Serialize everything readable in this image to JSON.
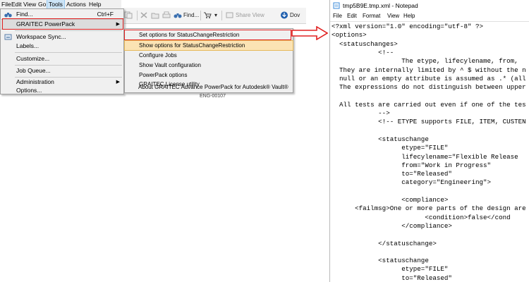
{
  "vault_menubar": {
    "items": [
      "File",
      "Edit",
      "View",
      "Go",
      "Tools",
      "Actions",
      "Help"
    ],
    "active": "Tools"
  },
  "vault_toolbar": {
    "find_label": "Find...",
    "share_view_label": "Share View",
    "download_label": "Dov"
  },
  "tools_menu": {
    "find": {
      "label": "Find...",
      "shortcut": "Ctrl+F"
    },
    "graitec_powerpack": "GRAITEC PowerPack",
    "workspace_sync": "Workspace Sync...",
    "labels": "Labels...",
    "customize": "Customize...",
    "job_queue": "Job Queue...",
    "administration": "Administration",
    "options": "Options..."
  },
  "submenu": {
    "items": [
      "Set options for StatusChangeRestriction",
      "Show options for StatusChangeRestriction",
      "Configure Jobs",
      "Show Vault configuration",
      "PowerPack options",
      "GRAITEC License utility",
      "About GRAITEC Advance PowerPack for Autodesk® Vault®"
    ],
    "selected_index": 1
  },
  "background_row": "ENG-00107",
  "notepad": {
    "title": "tmp5B9E.tmp.xml - Notepad",
    "menu": [
      "File",
      "Edit",
      "Format",
      "View",
      "Help"
    ],
    "lines": [
      "<?xml version=\"1.0\" encoding=\"utf-8\" ?>",
      "<options>",
      "  <statuschanges>",
      "            <!--",
      "                  The etype, lifecylename, from,",
      "  They are internally limited by ^ $ without the n",
      "  null or an empty attribute is assumed as .* (all",
      "  The expressions do not distinguish between upper",
      "",
      "  All tests are carried out even if one of the tes",
      "            -->",
      "            <!-- ETYPE supports FILE, ITEM, CUSTEN",
      "",
      "            <statuschange",
      "                  etype=\"FILE\"",
      "                  lifecylename=\"Flexible Release",
      "                  from=\"Work in Progress\"",
      "                  to=\"Released\"",
      "                  category=\"Engineering\">",
      "",
      "                  <compliance>",
      "      <failmsg>One or more parts of the design are i",
      "                        <condition>false</cond",
      "                  </compliance>",
      "",
      "            </statuschange>",
      "",
      "            <statuschange",
      "                  etype=\"FILE\"",
      "                  to=\"Released\""
    ]
  },
  "colors": {
    "highlight_red": "#e02020",
    "selected_item_bg": "#fbe3b4",
    "menu_bg": "#f0f0f0"
  }
}
